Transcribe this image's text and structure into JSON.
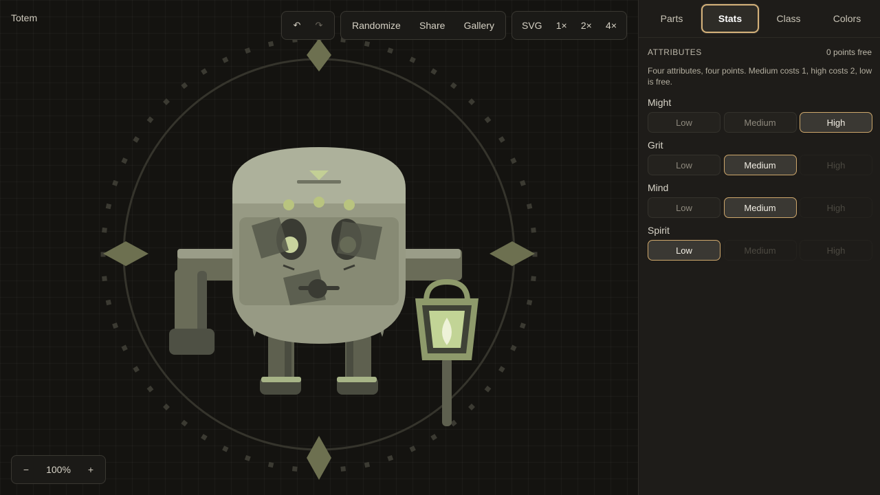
{
  "app": {
    "title": "Totem"
  },
  "toolbar": {
    "undo_icon": "undo-icon",
    "redo_icon": "redo-icon",
    "undo_glyph": "↶",
    "redo_glyph": "↷",
    "randomize": "Randomize",
    "share": "Share",
    "gallery": "Gallery",
    "svg": "SVG",
    "scale_1": "1×",
    "scale_2": "2×",
    "scale_4": "4×"
  },
  "zoom": {
    "minus": "−",
    "value": "100%",
    "plus": "+"
  },
  "tabs": [
    {
      "label": "Parts",
      "active": false
    },
    {
      "label": "Stats",
      "active": true
    },
    {
      "label": "Class",
      "active": false
    },
    {
      "label": "Colors",
      "active": false
    }
  ],
  "attributes": {
    "heading": "ATTRIBUTES",
    "points_free": "0 points free",
    "description": "Four attributes, four points. Medium costs 1, high costs 2, low is free.",
    "items": [
      {
        "name": "Might",
        "options": [
          "Low",
          "Medium",
          "High"
        ],
        "selected": "High",
        "disabled": []
      },
      {
        "name": "Grit",
        "options": [
          "Low",
          "Medium",
          "High"
        ],
        "selected": "Medium",
        "disabled": [
          "High"
        ]
      },
      {
        "name": "Mind",
        "options": [
          "Low",
          "Medium",
          "High"
        ],
        "selected": "Medium",
        "disabled": [
          "High"
        ]
      },
      {
        "name": "Spirit",
        "options": [
          "Low",
          "Medium",
          "High"
        ],
        "selected": "Low",
        "disabled": [
          "Medium",
          "High"
        ]
      }
    ]
  },
  "colors": {
    "accent": "#d5b27a",
    "canvas_bg": "#141310",
    "panel_bg": "#1e1c19",
    "totem_light": "#a9ad97",
    "totem_mid": "#8e917b",
    "totem_dark": "#60624f",
    "glow": "#c9d79b"
  }
}
